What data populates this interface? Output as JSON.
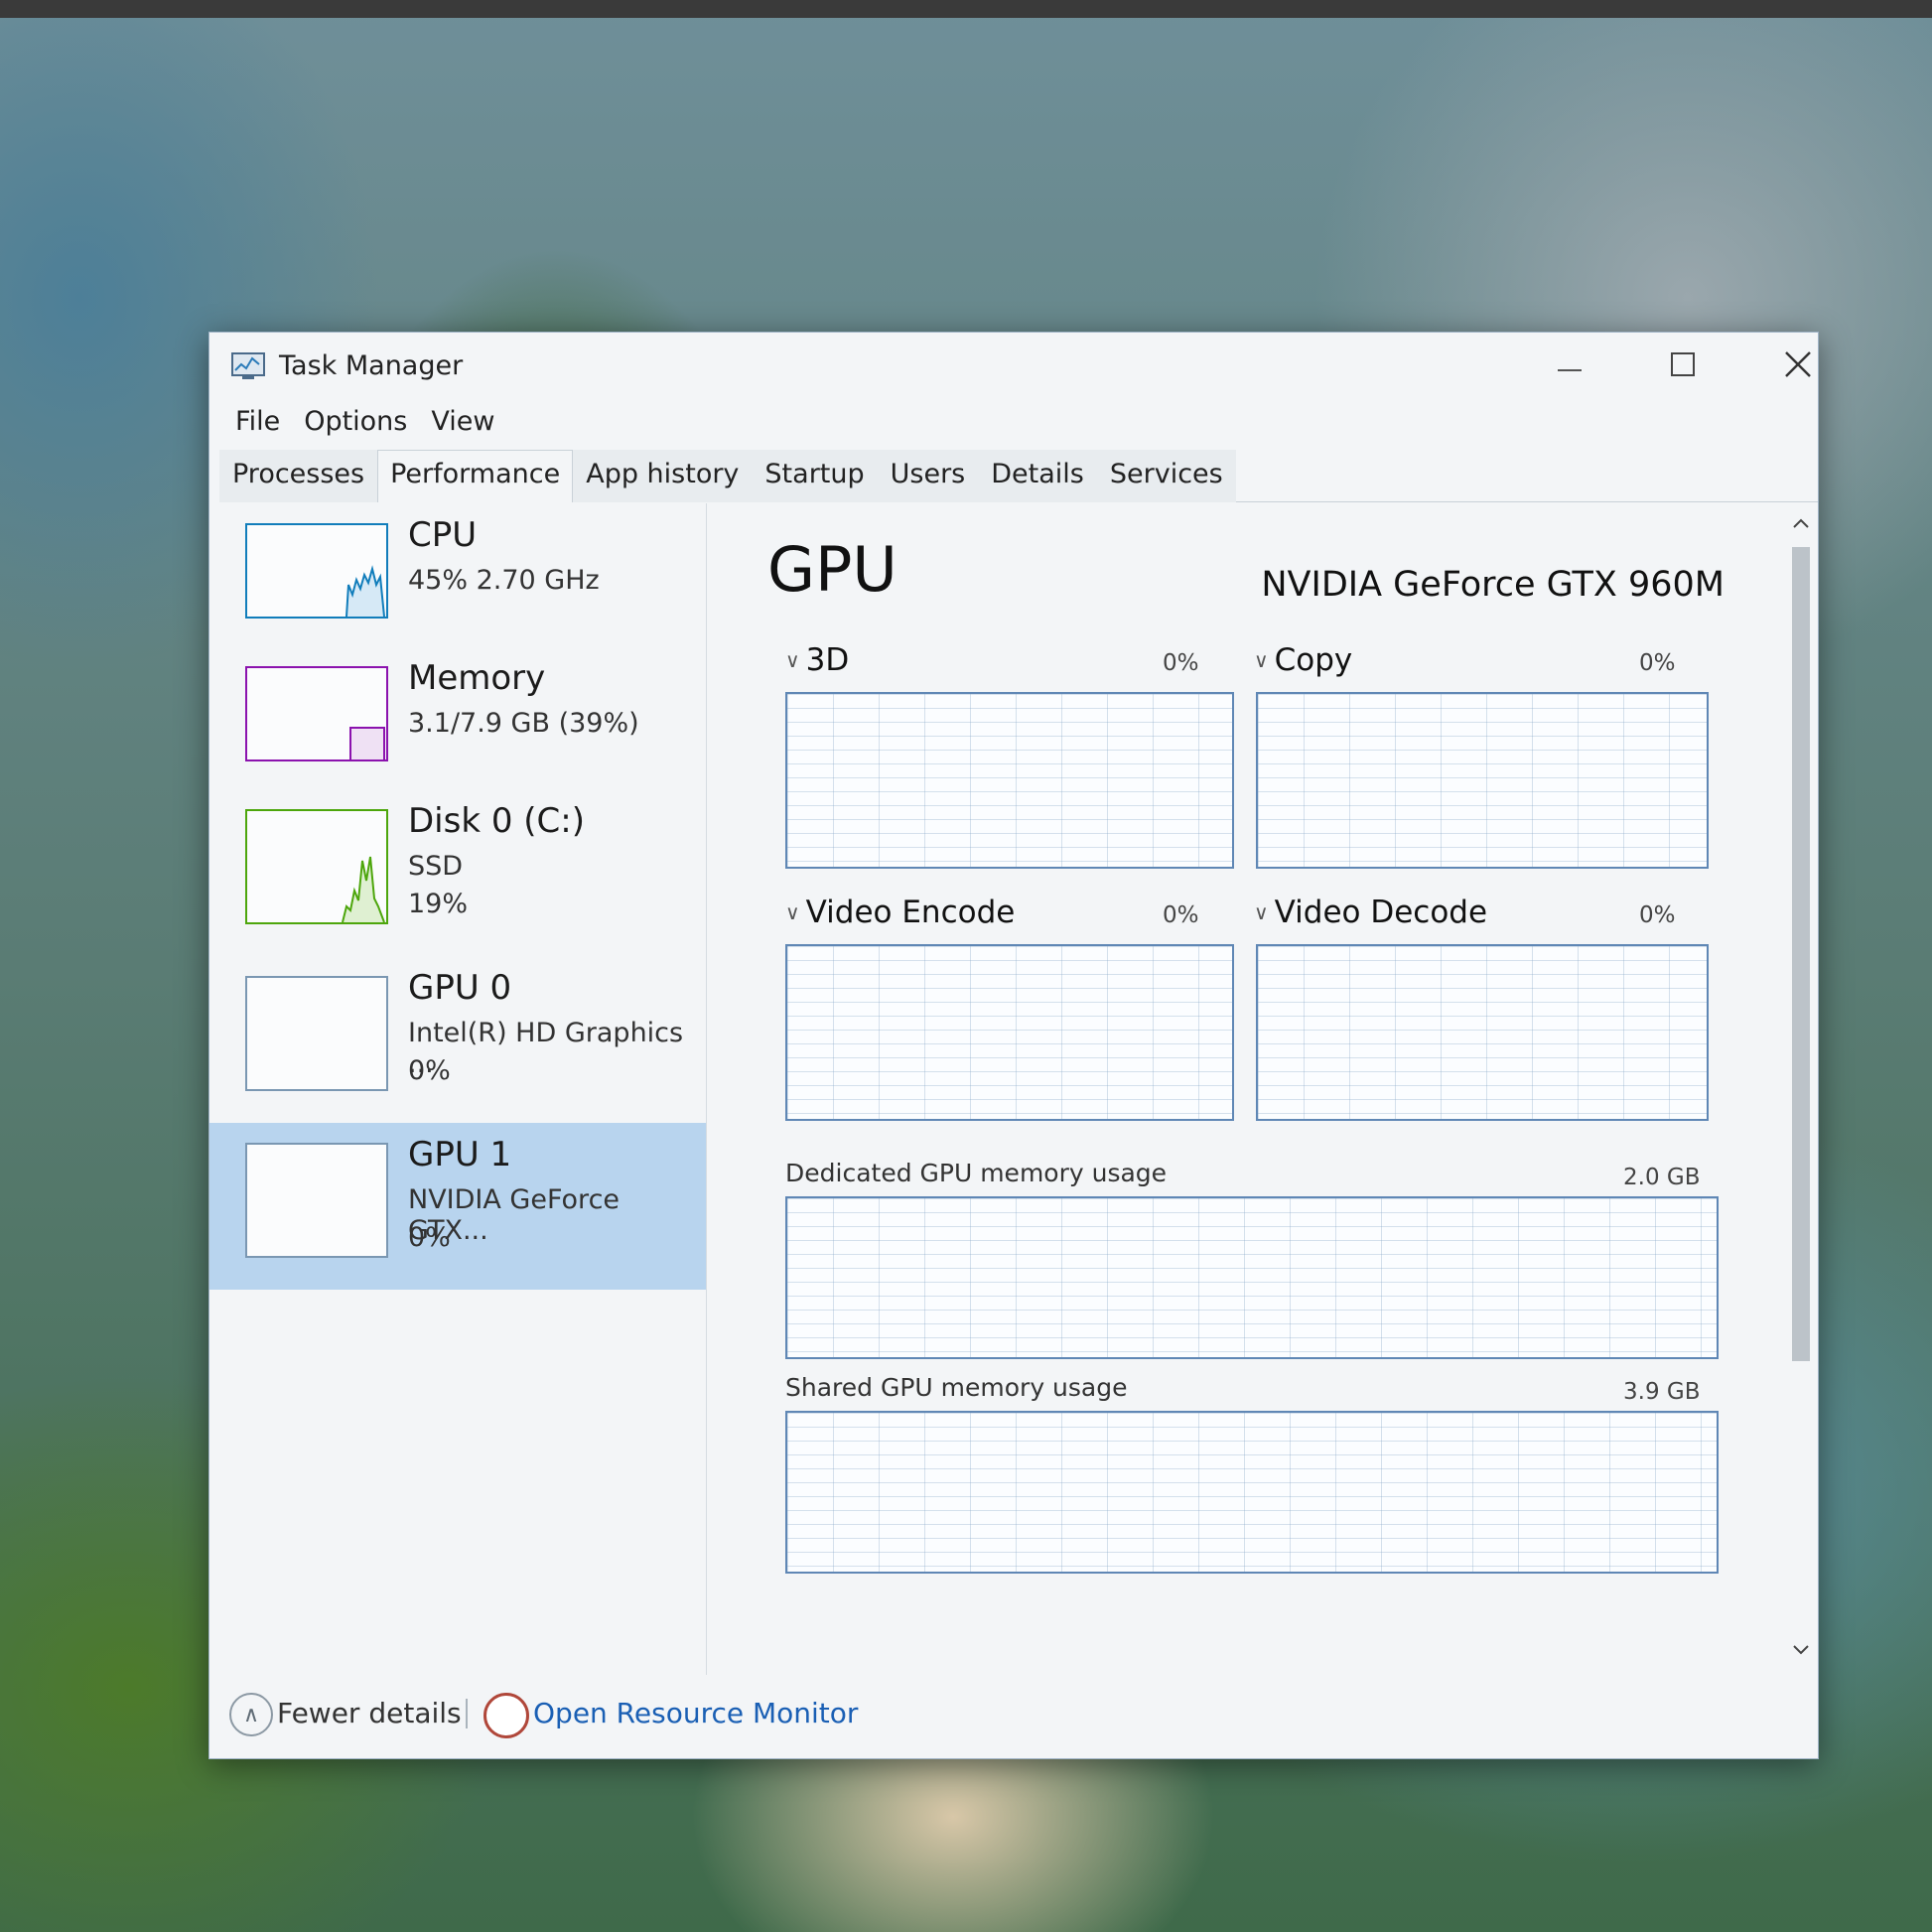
{
  "window": {
    "title": "Task Manager",
    "menu": [
      "File",
      "Options",
      "View"
    ],
    "tabs": [
      "Processes",
      "Performance",
      "App history",
      "Startup",
      "Users",
      "Details",
      "Services"
    ],
    "active_tab": "Performance"
  },
  "sidebar": {
    "items": [
      {
        "title": "CPU",
        "lines": [
          "45%  2.70 GHz"
        ],
        "graph_color": "#117dbb"
      },
      {
        "title": "Memory",
        "lines": [
          "3.1/7.9 GB (39%)"
        ],
        "graph_color": "#8b12ae"
      },
      {
        "title": "Disk 0 (C:)",
        "lines": [
          "SSD",
          "19%"
        ],
        "graph_color": "#4da60c"
      },
      {
        "title": "GPU 0",
        "lines": [
          "Intel(R) HD Graphics ...",
          "0%"
        ],
        "graph_color": "#5f87b5"
      },
      {
        "title": "GPU 1",
        "lines": [
          "NVIDIA GeForce GTX...",
          "0%"
        ],
        "graph_color": "#5f87b5",
        "selected": true
      }
    ]
  },
  "main": {
    "title": "GPU",
    "device_name": "NVIDIA GeForce GTX 960M",
    "graphs": [
      {
        "label": "3D",
        "percent": "0%"
      },
      {
        "label": "Copy",
        "percent": "0%"
      },
      {
        "label": "Video Encode",
        "percent": "0%"
      },
      {
        "label": "Video Decode",
        "percent": "0%"
      }
    ],
    "dedicated_memory": {
      "label": "Dedicated GPU memory usage",
      "value": "2.0 GB"
    },
    "shared_memory": {
      "label": "Shared GPU memory usage",
      "value": "3.9 GB"
    }
  },
  "footer": {
    "fewer_details": "Fewer details",
    "open_resource_monitor": "Open Resource Monitor"
  }
}
